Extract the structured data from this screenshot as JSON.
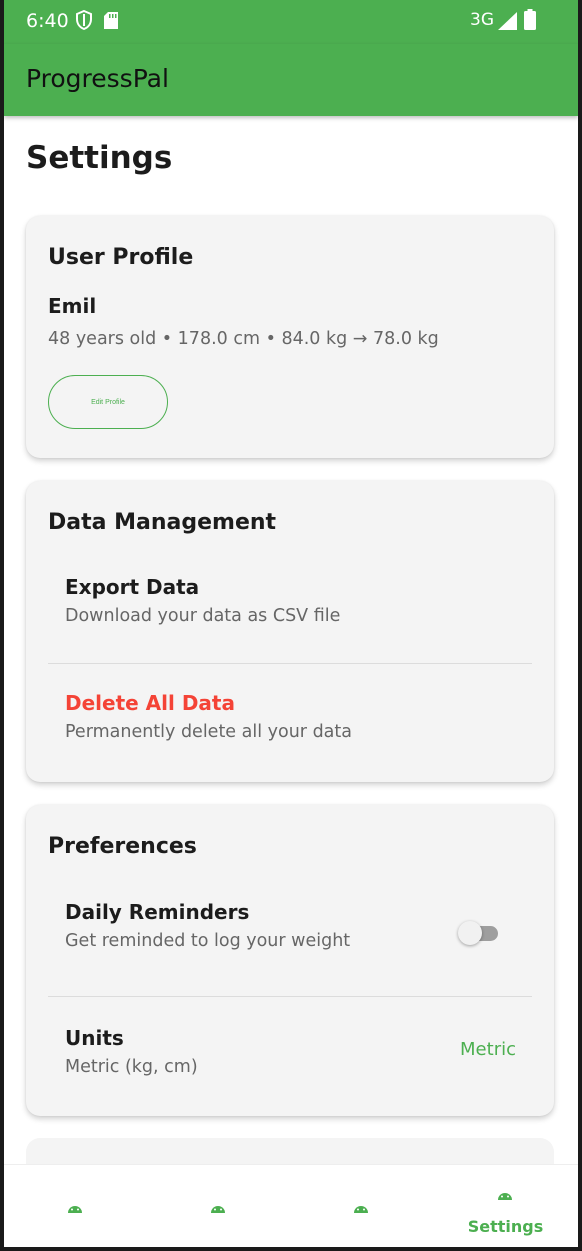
{
  "status_bar": {
    "time": "6:40",
    "network": "3G"
  },
  "app_bar": {
    "title": "ProgressPal"
  },
  "page": {
    "title": "Settings"
  },
  "user_profile": {
    "title": "User Profile",
    "name": "Emil",
    "stats": "48 years old • 178.0 cm • 84.0 kg → 78.0 kg",
    "edit_button": "Edit Profile"
  },
  "data_management": {
    "title": "Data Management",
    "export": {
      "title": "Export Data",
      "subtitle": "Download your data as CSV file"
    },
    "delete": {
      "title": "Delete All Data",
      "subtitle": "Permanently delete all your data"
    }
  },
  "preferences": {
    "title": "Preferences",
    "reminders": {
      "title": "Daily Reminders",
      "subtitle": "Get reminded to log your weight",
      "enabled": false
    },
    "units": {
      "title": "Units",
      "subtitle": "Metric (kg, cm)",
      "value": "Metric"
    }
  },
  "bottom_nav": {
    "items": [
      {
        "icon": "android-icon",
        "label": ""
      },
      {
        "icon": "android-icon",
        "label": ""
      },
      {
        "icon": "android-icon",
        "label": ""
      },
      {
        "icon": "android-icon",
        "label": "Settings",
        "selected": true
      }
    ]
  },
  "colors": {
    "primary": "#4caf50",
    "danger": "#f44336",
    "card": "#f4f4f4"
  }
}
